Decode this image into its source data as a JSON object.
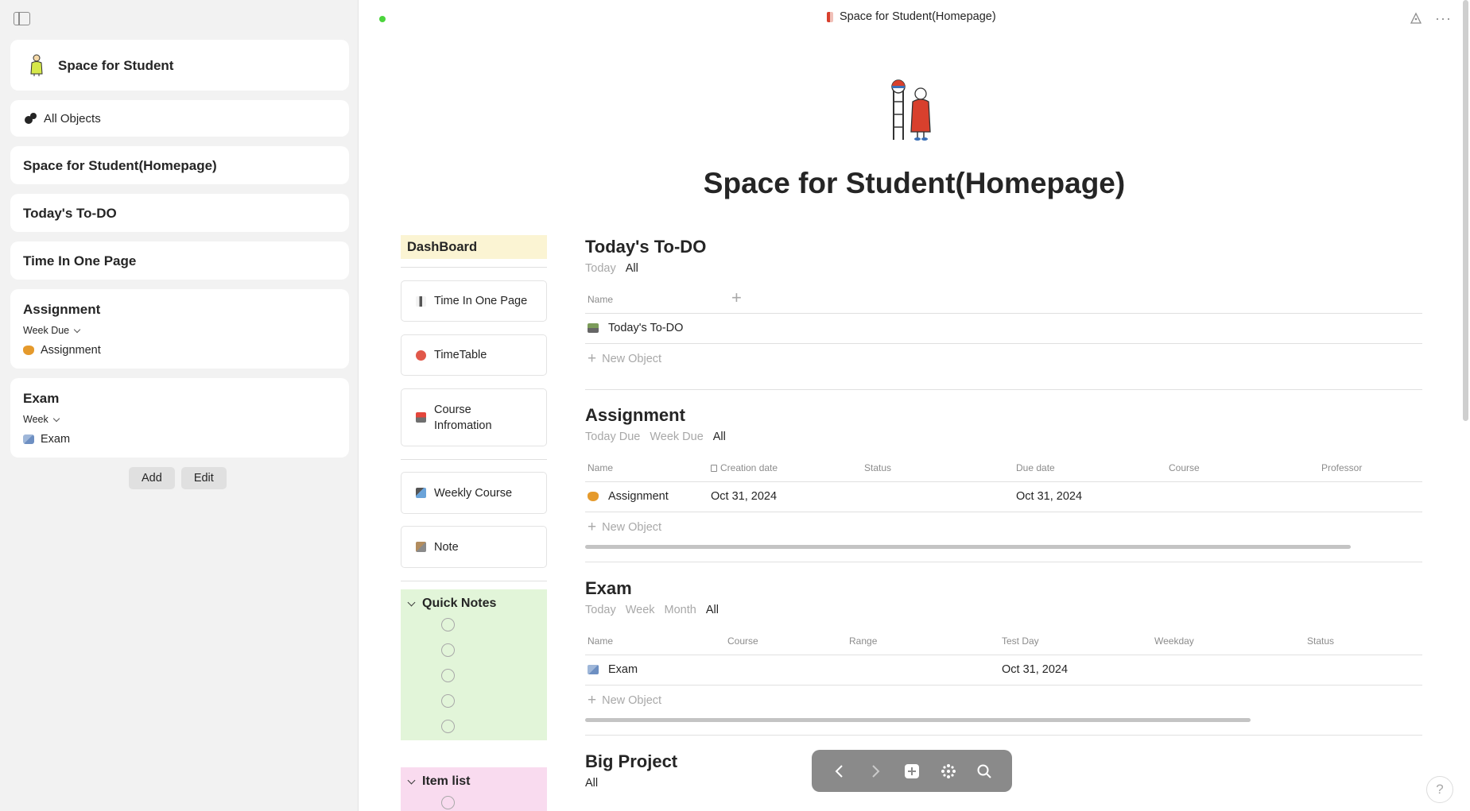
{
  "sidebar": {
    "space_name": "Space for Student",
    "all_objects_label": "All Objects",
    "pages": [
      "Space for Student(Homepage)",
      "Today's To-DO",
      "Time In One Page"
    ],
    "assignment_widget": {
      "title": "Assignment",
      "filter": "Week Due",
      "item": "Assignment"
    },
    "exam_widget": {
      "title": "Exam",
      "filter": "Week",
      "item": "Exam"
    },
    "add_label": "Add",
    "edit_label": "Edit"
  },
  "header": {
    "title": "Space for Student(Homepage)",
    "sync_status_color": "#4bd43c"
  },
  "page": {
    "title": "Space for Student(Homepage)"
  },
  "dashboard": {
    "header": "DashBoard",
    "links": [
      "Time In One Page",
      "TimeTable",
      "Course Infromation",
      "Weekly Course",
      "Note"
    ],
    "quick_notes_title": "Quick Notes",
    "item_list_title": "Item list"
  },
  "todo": {
    "title": "Today's To-DO",
    "views": [
      "Today",
      "All"
    ],
    "columns": [
      "Name"
    ],
    "rows": [
      {
        "name": "Today's To-DO"
      }
    ],
    "new_object": "New Object"
  },
  "assignment": {
    "title": "Assignment",
    "views": [
      "Today Due",
      "Week Due",
      "All"
    ],
    "columns": [
      "Name",
      "Creation date",
      "Status",
      "Due date",
      "Course",
      "Professor"
    ],
    "rows": [
      {
        "name": "Assignment",
        "creation_date": "Oct 31, 2024",
        "due_date": "Oct 31, 2024"
      }
    ],
    "new_object": "New Object"
  },
  "exam": {
    "title": "Exam",
    "views": [
      "Today",
      "Week",
      "Month",
      "All"
    ],
    "columns": [
      "Name",
      "Course",
      "Range",
      "Test Day",
      "Weekday",
      "Status"
    ],
    "rows": [
      {
        "name": "Exam",
        "test_day": "Oct 31, 2024"
      }
    ],
    "new_object": "New Object"
  },
  "big_project": {
    "title": "Big Project",
    "views": [
      "All"
    ]
  },
  "colors": {
    "dashboard_bg": "#fbf4d3",
    "quick_notes_bg": "#e2f5d9",
    "item_list_bg": "#f9dbef",
    "sidebar_bg": "#f2f2f2"
  },
  "icons": [
    "sidebar-toggle-icon",
    "graph-icon",
    "more-icon",
    "back-icon",
    "forward-icon",
    "add-icon",
    "widgets-icon",
    "search-icon",
    "help-icon"
  ],
  "help_label": "?"
}
